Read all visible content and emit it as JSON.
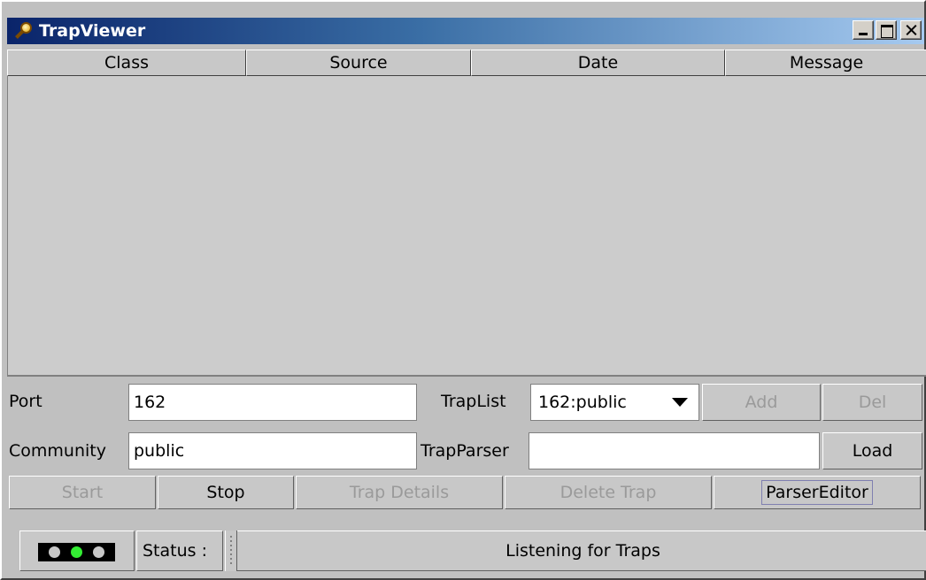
{
  "window": {
    "title": "TrapViewer"
  },
  "table": {
    "columns": [
      "Class",
      "Source",
      "Date",
      "Message"
    ]
  },
  "form": {
    "port_label": "Port",
    "port_value": "162",
    "community_label": "Community",
    "community_value": "public",
    "traplist_label": "TrapList",
    "traplist_selected": "162:public",
    "trapparser_label": "TrapParser",
    "trapparser_value": "",
    "add_label": "Add",
    "del_label": "Del",
    "load_label": "Load"
  },
  "actions": {
    "start_label": "Start",
    "stop_label": "Stop",
    "trap_details_label": "Trap Details",
    "delete_trap_label": "Delete Trap",
    "parser_editor_label": "ParserEditor"
  },
  "status": {
    "label": "Status :",
    "text": "Listening for Traps",
    "lights": [
      "off",
      "on",
      "off"
    ],
    "light_color_on": "#33ee33"
  },
  "icons": {
    "app": "magnifier-icon"
  }
}
